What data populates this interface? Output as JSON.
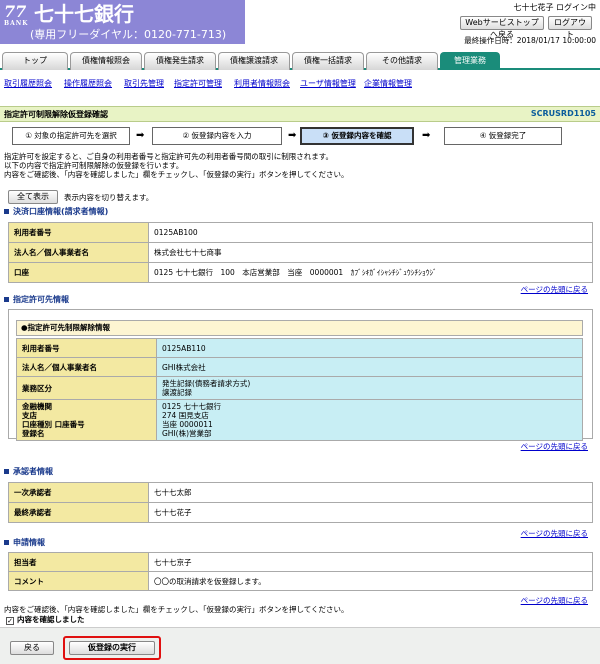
{
  "header": {
    "logo_num": "77",
    "logo_sub": "BANK",
    "bank_name": "七十七銀行",
    "freedial": "(専用フリーダイヤル：0120-771-713)",
    "user": "七十七花子 ログイン中",
    "top_button": "Webサービストップへ戻る",
    "logout_button": "ログアウト",
    "last_operation": "最終操作日時：2018/01/17 10:00:00"
  },
  "tabs": [
    "トップ",
    "債権情報照会",
    "債権発生請求",
    "債権譲渡請求",
    "債権一括請求",
    "その他請求",
    "管理業務"
  ],
  "submenu": [
    "取引履歴照会",
    "操作履歴照会",
    "取引先管理",
    "指定許可管理",
    "利用者情報照会",
    "ユーザ情報管理",
    "企業情報管理"
  ],
  "title": "指定許可制限解除仮登録確認",
  "screen_id": "SCRUSRD1105",
  "steps": [
    "① 対象の指定許可先を選択",
    "② 仮登録内容を入力",
    "③ 仮登録内容を確認",
    "④ 仮登録完了"
  ],
  "instructions": [
    "指定許可を設定すると、ご自身の利用者番号と指定許可先の利用者番号間の取引に制限されます。",
    "以下の内容で指定許可制限解除の仮登録を行います。",
    "内容をご確認後、「内容を確認しました」欄をチェックし、「仮登録の実行」ボタンを押してください。"
  ],
  "show_all_button": "全て表示",
  "show_all_label": "表示内容を切り替えます。",
  "sections": {
    "settlement": {
      "heading": "決済口座情報(請求者情報)",
      "rows": [
        {
          "k": "利用者番号",
          "v": "0125AB100"
        },
        {
          "k": "法人名／個人事業者名",
          "v": "株式会社七十七商事"
        },
        {
          "k": "口座",
          "v": "0125 七十七銀行　100　本店営業部　当座　0000001　ｶﾌﾞｼｷｶﾞｲｼｬｼﾁｼﾞｭｳｼﾁｼｮｳｼﾞ"
        }
      ]
    },
    "permitted": {
      "heading": "指定許可先情報",
      "subheading": "●指定許可先制限解除情報",
      "rows": [
        {
          "k": "利用者番号",
          "v": "0125AB110"
        },
        {
          "k": "法人名／個人事業者名",
          "v": "GHI株式会社"
        }
      ],
      "business_label": "業務区分",
      "business_lines": [
        "発生記録(債務者請求方式)",
        "譲渡記録"
      ],
      "account_labels": [
        "金融機関",
        "支店",
        "口座種別 口座番号",
        "登録名"
      ],
      "account_values": [
        "0125 七十七銀行",
        "274 国見支店",
        "当座 0000011",
        "GHI(株)営業部"
      ]
    },
    "approver": {
      "heading": "承認者情報",
      "rows": [
        {
          "k": "一次承認者",
          "v": "七十七太郎"
        },
        {
          "k": "最終承認者",
          "v": "七十七花子"
        }
      ]
    },
    "application": {
      "heading": "申請情報",
      "rows": [
        {
          "k": "担当者",
          "v": "七十七京子"
        },
        {
          "k": "コメント",
          "v": "〇〇の取消請求を仮登録します。"
        }
      ]
    }
  },
  "page_top_link": "ページの先頭に戻る",
  "confirm_text": "内容をご確認後、「内容を確認しました」欄をチェックし、「仮登録の実行」ボタンを押してください。",
  "checkbox_label": "内容を確認しました",
  "checkbox_mark": "✓",
  "back_button": "戻る",
  "execute_button": "仮登録の実行"
}
